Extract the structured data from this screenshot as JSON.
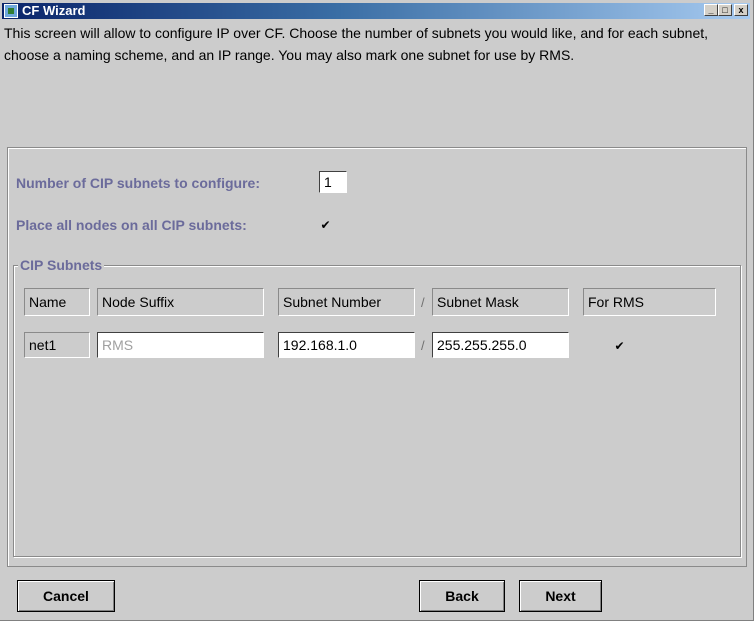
{
  "window": {
    "title": "CF Wizard",
    "minimize_glyph": "_",
    "maximize_glyph": "□",
    "close_glyph": "x"
  },
  "intro": {
    "text": "This screen will allow to configure IP over CF.  Choose the number of subnets you would like, and for each subnet, choose a naming scheme, and an IP range.  You may also mark one subnet for use by RMS."
  },
  "config": {
    "subnets_label": "Number of CIP subnets to configure:",
    "subnets_value": "1",
    "place_all_label": "Place all nodes on all CIP subnets:",
    "place_all_checked": true,
    "check_glyph": "✔"
  },
  "cip_subnets": {
    "legend": "CIP Subnets",
    "headers": {
      "name": "Name",
      "node_suffix": "Node Suffix",
      "subnet_number": "Subnet Number",
      "separator": "/",
      "subnet_mask": "Subnet Mask",
      "for_rms": "For RMS"
    },
    "rows": [
      {
        "name": "net1",
        "node_suffix": "RMS",
        "subnet_number": "192.168.1.0",
        "separator": "/",
        "subnet_mask": "255.255.255.0",
        "for_rms_checked": true
      }
    ]
  },
  "buttons": {
    "cancel": "Cancel",
    "back": "Back",
    "next": "Next"
  },
  "colors": {
    "window_bg": "#cccccc",
    "label_color": "#6b6b9b",
    "titlebar_start": "#0a246a"
  }
}
